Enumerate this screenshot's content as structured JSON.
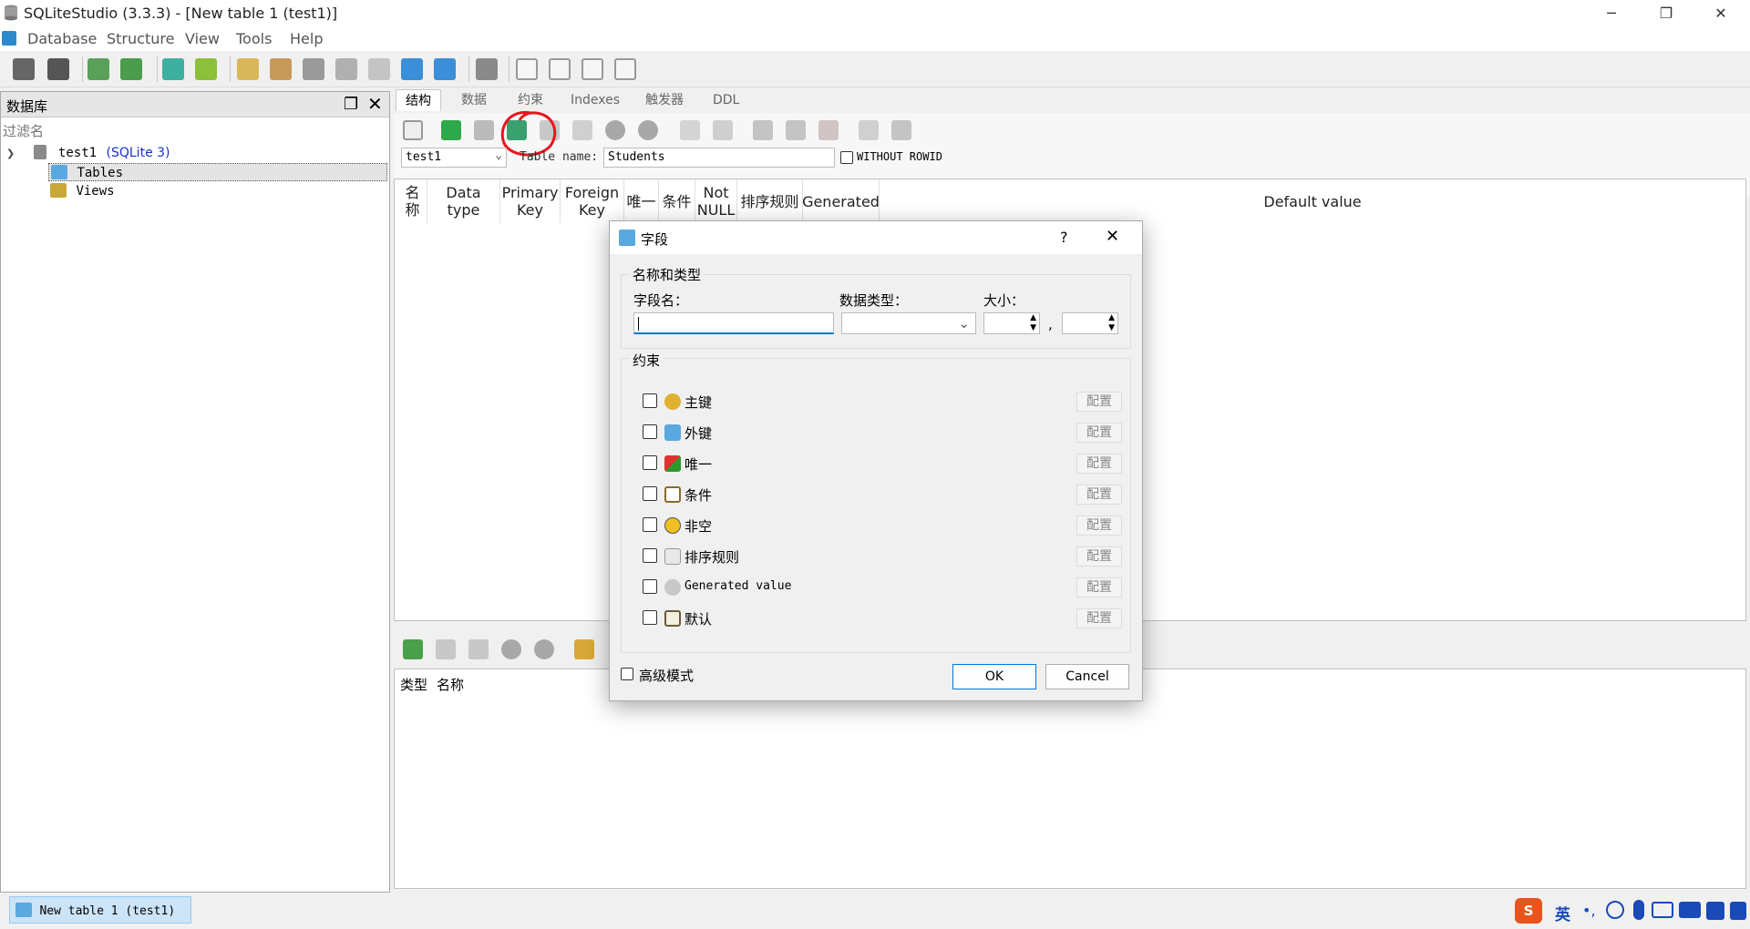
{
  "window": {
    "title": "SQLiteStudio (3.3.3) - [New table 1 (test1)]"
  },
  "menu": [
    {
      "label": "Database"
    },
    {
      "label": "Structure"
    },
    {
      "label": "View"
    },
    {
      "label": "Tools"
    },
    {
      "label": "Help"
    }
  ],
  "db_panel": {
    "title": "数据库",
    "filter_placeholder": "过滤名",
    "tree": {
      "db_name": "test1",
      "db_type": "(SQLite 3)",
      "tables": "Tables",
      "views": "Views"
    }
  },
  "editor": {
    "tabs": [
      "结构",
      "数据",
      "约束",
      "Indexes",
      "触发器",
      "DDL"
    ],
    "db_select": "test1",
    "table_name_label": "Table name:",
    "table_name_value": "Students",
    "without_rowid_label": "WITHOUT ROWID",
    "columns": [
      "名称",
      "Data type",
      "Primary\nKey",
      "Foreign\nKey",
      "唯一",
      "条件",
      "Not\nNULL",
      "排序规则",
      "Generated",
      "Default value"
    ],
    "constraint_columns": [
      "类型",
      "名称"
    ]
  },
  "status": {
    "task_label": "New table 1 (test1)",
    "ime_lang": "英"
  },
  "dialog": {
    "title": "字段",
    "help_label": "?",
    "close_label": "✕",
    "group_name_type": "名称和类型",
    "field_name_label": "字段名：",
    "data_type_label": "数据类型：",
    "size_label": "大小：",
    "size_sep": ",",
    "group_constraints": "约束",
    "constraints": [
      {
        "label": "主键",
        "icon": "key-icon"
      },
      {
        "label": "外键",
        "icon": "foreign-key-icon"
      },
      {
        "label": "唯一",
        "icon": "unique-icon"
      },
      {
        "label": "条件",
        "icon": "check-icon"
      },
      {
        "label": "非空",
        "icon": "not-null-icon"
      },
      {
        "label": "排序规则",
        "icon": "collation-icon"
      },
      {
        "label": "Generated value",
        "icon": "generated-icon"
      },
      {
        "label": "默认",
        "icon": "default-icon"
      }
    ],
    "configure_label": "配置",
    "advanced_mode_label": "高级模式",
    "ok_label": "OK",
    "cancel_label": "Cancel"
  },
  "colors": {
    "accent": "#0078d7",
    "annotation": "#e8141c",
    "link_blue": "#1a32c8"
  }
}
